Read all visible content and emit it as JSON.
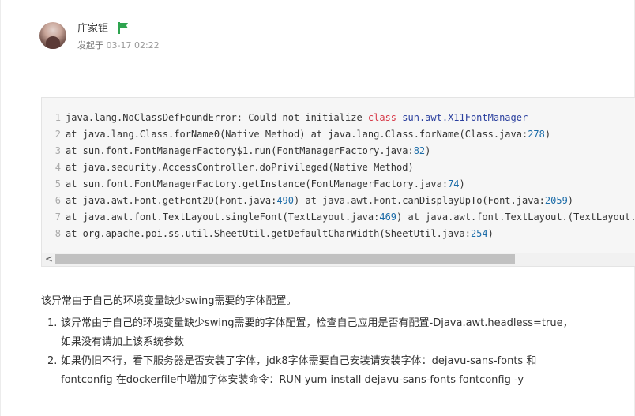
{
  "author": {
    "name": "庄家钜",
    "meta_prefix": "发起于",
    "meta_time": "03-17 02:22",
    "flag_color": "#2ea44f"
  },
  "code": {
    "lines": [
      {
        "num": "1",
        "tokens": [
          {
            "t": "java.lang.NoClassDefFoundError: Could not initialize "
          },
          {
            "t": "class",
            "c": "kw"
          },
          {
            "t": " "
          },
          {
            "t": "sun.awt.X11FontManager",
            "c": "cls"
          }
        ]
      },
      {
        "num": "2",
        "tokens": [
          {
            "t": "at java.lang.Class.forName0(Native Method) at java.lang.Class.forName(Class.java:"
          },
          {
            "t": "278",
            "c": "num"
          },
          {
            "t": ")"
          }
        ]
      },
      {
        "num": "3",
        "tokens": [
          {
            "t": "at sun.font.FontManagerFactory$1.run(FontManagerFactory.java:"
          },
          {
            "t": "82",
            "c": "num"
          },
          {
            "t": ")"
          }
        ]
      },
      {
        "num": "4",
        "tokens": [
          {
            "t": "at java.security.AccessController.doPrivileged(Native Method)"
          }
        ]
      },
      {
        "num": "5",
        "tokens": [
          {
            "t": "at sun.font.FontManagerFactory.getInstance(FontManagerFactory.java:"
          },
          {
            "t": "74",
            "c": "num"
          },
          {
            "t": ")"
          }
        ]
      },
      {
        "num": "6",
        "tokens": [
          {
            "t": "at java.awt.Font.getFont2D(Font.java:"
          },
          {
            "t": "490",
            "c": "num"
          },
          {
            "t": ") at java.awt.Font.canDisplayUpTo(Font.java:"
          },
          {
            "t": "2059",
            "c": "num"
          },
          {
            "t": ")"
          }
        ]
      },
      {
        "num": "7",
        "tokens": [
          {
            "t": "at java.awt.font.TextLayout.singleFont(TextLayout.java:"
          },
          {
            "t": "469",
            "c": "num"
          },
          {
            "t": ") at java.awt.font.TextLayout.(TextLayout.java:"
          }
        ]
      },
      {
        "num": "8",
        "tokens": [
          {
            "t": "at org.apache.poi.ss.util.SheetUtil.getDefaultCharWidth(SheetUtil.java:"
          },
          {
            "t": "254",
            "c": "num"
          },
          {
            "t": ")"
          }
        ]
      }
    ],
    "colors": {
      "keyword": "#d73a49",
      "class": "#2a3f9e",
      "number": "#1c6ca8"
    }
  },
  "scrollbar": {
    "left_arrow": "<"
  },
  "body": {
    "intro": "该异常由于自己的环境变量缺少swing需要的字体配置。",
    "list": [
      {
        "num": "1.",
        "line1": "该异常由于自己的环境变量缺少swing需要的字体配置，检查自己应用是否有配置-Djava.awt.headless=true，",
        "line2": "如果没有请加上该系统参数"
      },
      {
        "num": "2.",
        "line1": "如果仍旧不行，看下服务器是否安装了字体，jdk8字体需要自己安装请安装字体：dejavu-sans-fonts 和",
        "line2": "fontconfig 在dockerfile中增加字体安装命令：RUN yum install dejavu-sans-fonts fontconfig -y"
      }
    ]
  }
}
